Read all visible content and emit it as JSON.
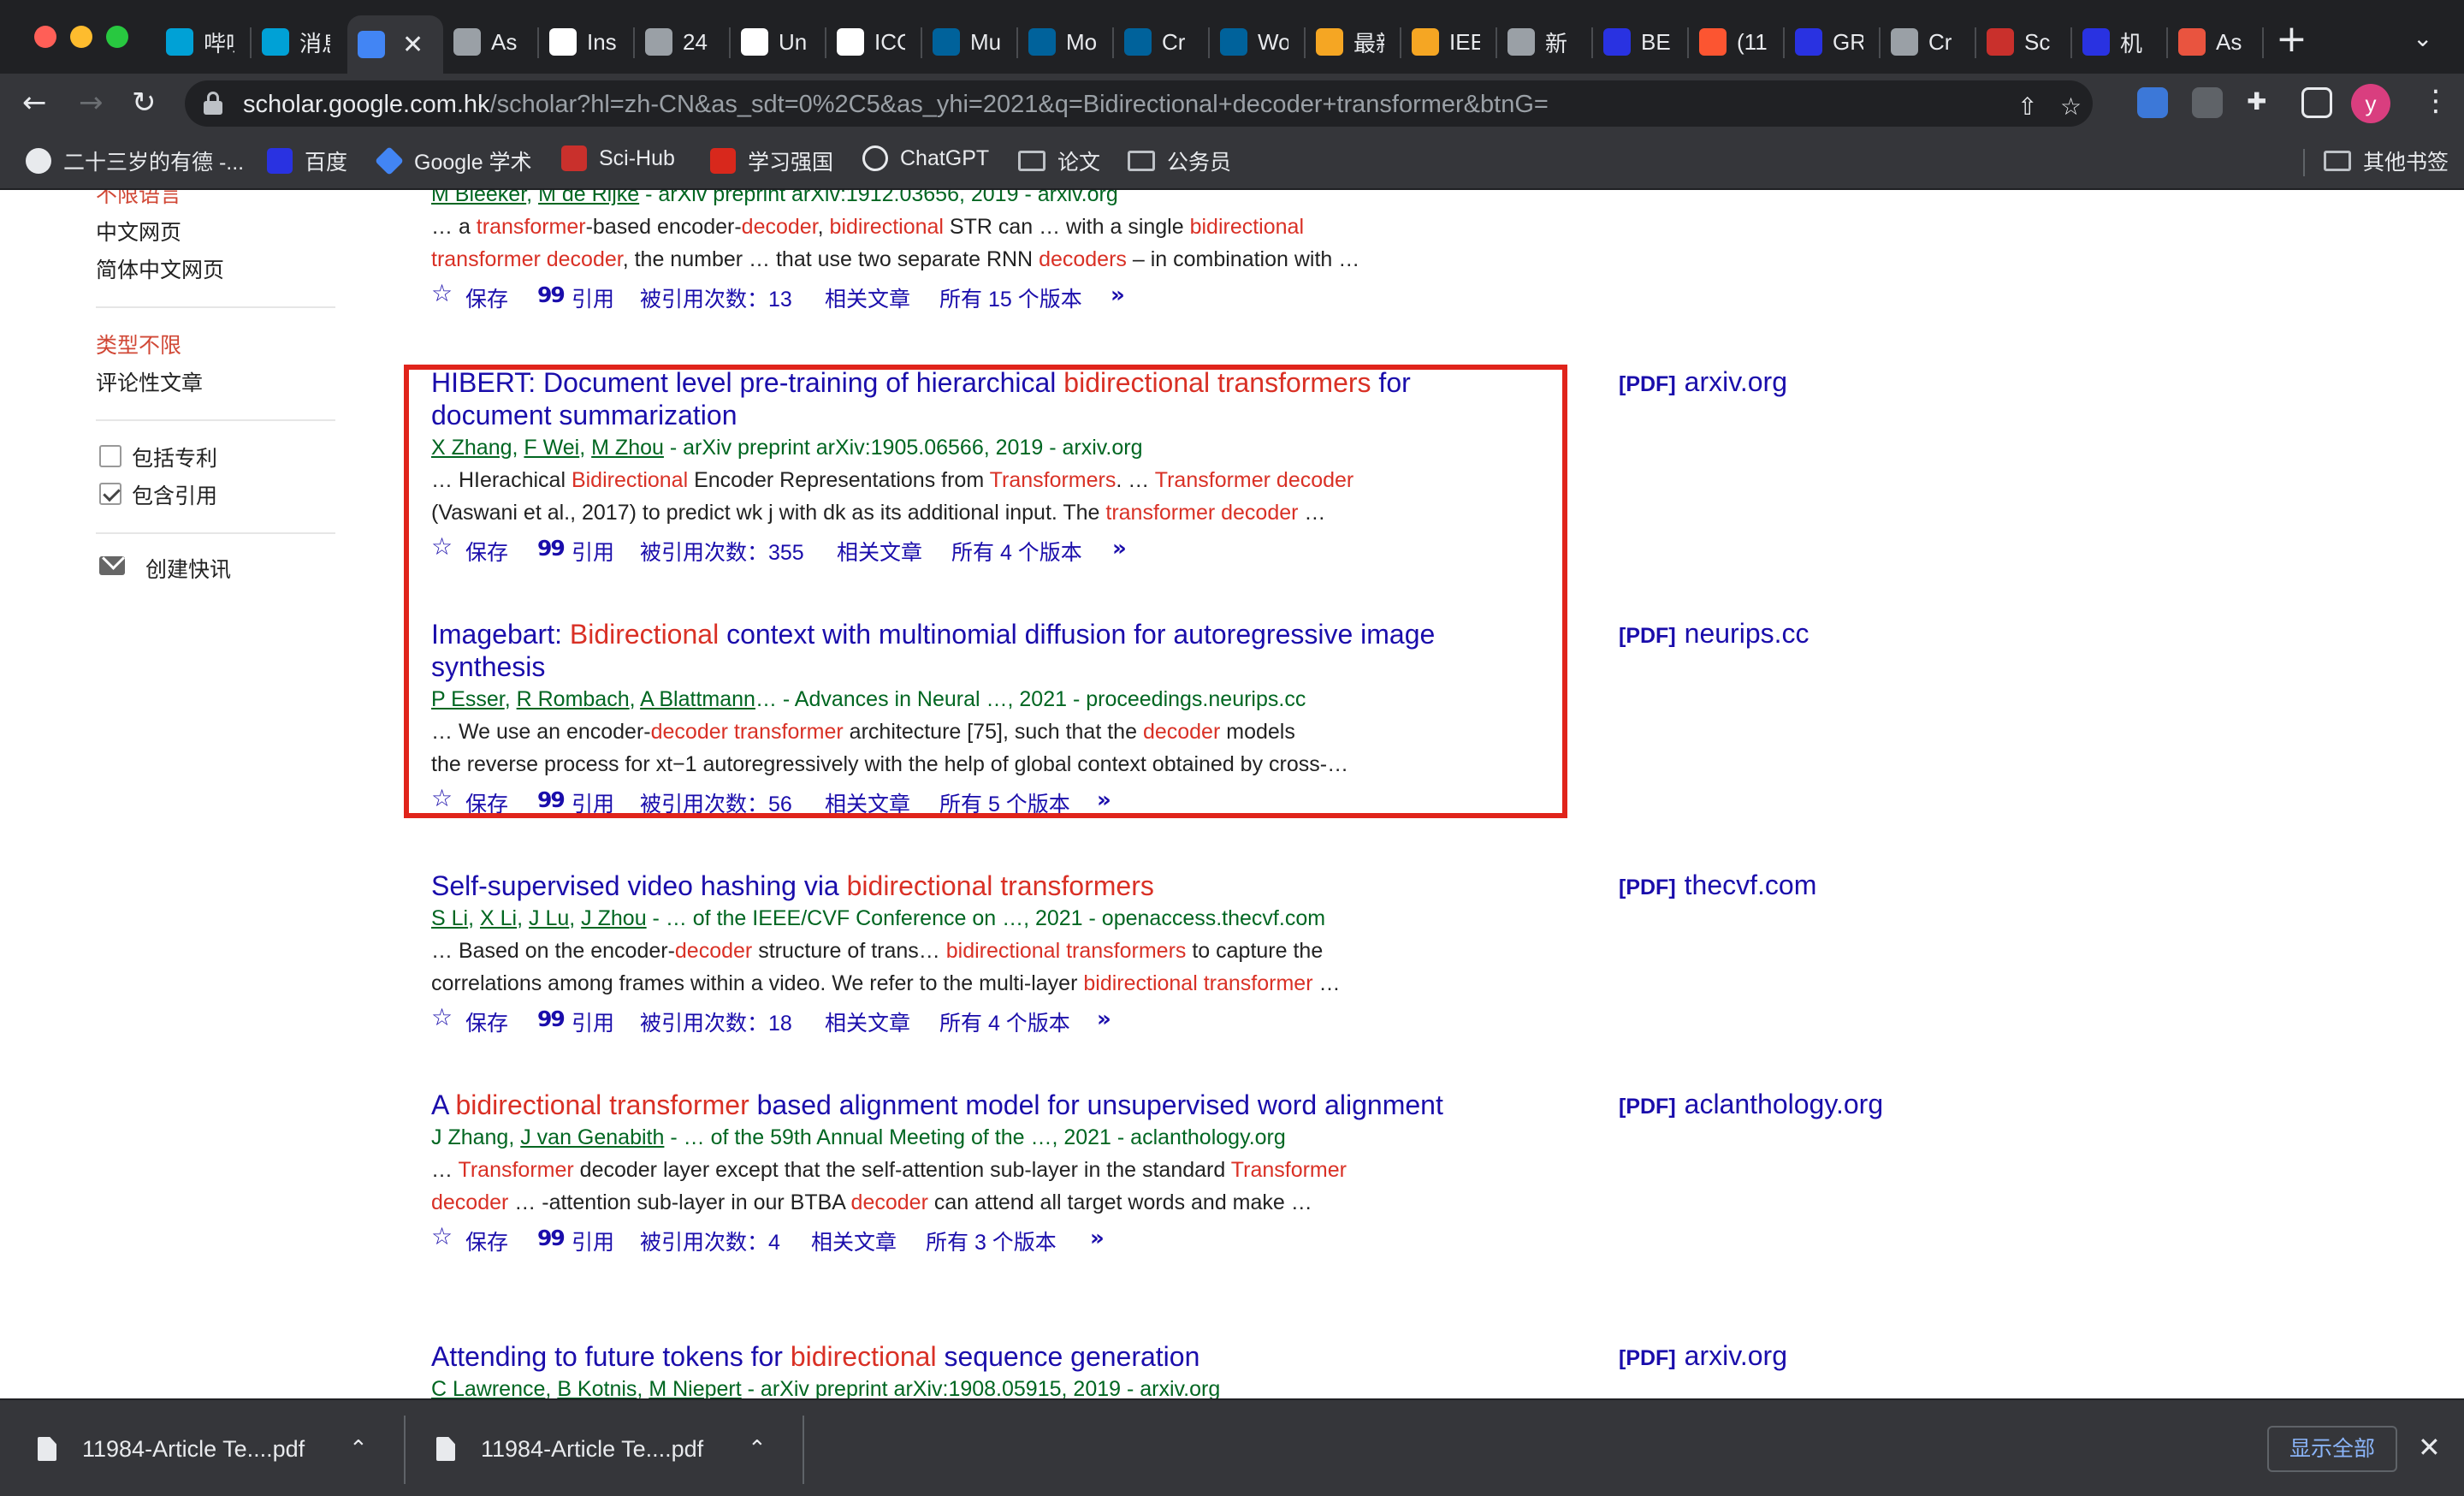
{
  "browser": {
    "tabs": [
      {
        "title": "哔哩",
        "icon": "bilibili-icon",
        "color": "#00a1d6"
      },
      {
        "title": "消息",
        "icon": "bilibili-icon",
        "color": "#00a1d6"
      },
      {
        "title": "",
        "icon": "google-scholar-icon",
        "color": "#4285f4",
        "active": true
      },
      {
        "title": "As",
        "icon": "globe-icon",
        "color": "#9aa0a6"
      },
      {
        "title": "Ins",
        "icon": "researchgate-icon",
        "color": "#ffffff"
      },
      {
        "title": "24",
        "icon": "globe-icon",
        "color": "#9aa0a6"
      },
      {
        "title": "Un",
        "icon": "cvf-icon",
        "color": "#ffffff"
      },
      {
        "title": "ICC",
        "icon": "cvf-icon",
        "color": "#ffffff"
      },
      {
        "title": "Mu",
        "icon": "ieee-icon",
        "color": "#00629b"
      },
      {
        "title": "Mo",
        "icon": "ieee-icon",
        "color": "#00629b"
      },
      {
        "title": "Cr",
        "icon": "ieee-icon",
        "color": "#00629b"
      },
      {
        "title": "Wo",
        "icon": "ieee-icon",
        "color": "#00629b"
      },
      {
        "title": "最新",
        "icon": "p-coin-icon",
        "color": "#f5a623"
      },
      {
        "title": "IEE",
        "icon": "p-coin-icon",
        "color": "#f5a623"
      },
      {
        "title": "新",
        "icon": "globe-icon",
        "color": "#9aa0a6"
      },
      {
        "title": "BE",
        "icon": "baidu-icon",
        "color": "#2932e1"
      },
      {
        "title": "(11",
        "icon": "c-icon",
        "color": "#fc5531"
      },
      {
        "title": "GR",
        "icon": "baidu-icon",
        "color": "#2932e1"
      },
      {
        "title": "Cr",
        "icon": "globe-icon",
        "color": "#9aa0a6"
      },
      {
        "title": "Sc",
        "icon": "scihub-icon",
        "color": "#c9302c"
      },
      {
        "title": "机",
        "icon": "baidu-icon",
        "color": "#2932e1"
      },
      {
        "title": "As",
        "icon": "jian-icon",
        "color": "#e9543f"
      }
    ],
    "url_host": "scholar.google.com.hk",
    "url_path": "/scholar?hl=zh-CN&as_sdt=0%2C5&as_yhi=2021&q=Bidirectional+decoder+transformer&btnG=",
    "bookmarks": [
      {
        "label": "二十三岁的有德 -...",
        "icon": "custom-logo-icon"
      },
      {
        "label": "百度",
        "icon": "baidu-icon"
      },
      {
        "label": "Google 学术",
        "icon": "google-scholar-icon"
      },
      {
        "label": "Sci-Hub",
        "icon": "scihub-icon"
      },
      {
        "label": "学习强国",
        "icon": "xuexi-icon"
      },
      {
        "label": "ChatGPT",
        "icon": "openai-icon"
      },
      {
        "label": "论文",
        "icon": "folder-icon"
      },
      {
        "label": "公务员",
        "icon": "folder-icon"
      }
    ],
    "other_bookmarks": "其他书签",
    "profile_initial": "y"
  },
  "sidebar": {
    "lang_any": "不限语言",
    "lang_zh": "中文网页",
    "lang_zh_simplified": "简体中文网页",
    "type_any": "类型不限",
    "type_review": "评论性文章",
    "include_patents": "包括专利",
    "include_citations": "包含引用",
    "create_alert": "创建快讯"
  },
  "actions": {
    "save": "保存",
    "cite": "引用",
    "related": "相关文章"
  },
  "results": [
    {
      "id": "r0",
      "title_parts": [],
      "authors": [
        "M Bleeker",
        "M de Rijke"
      ],
      "authors_plain_tail": "",
      "venue": " - arXiv preprint arXiv:1912.03656, 2019 - arxiv.org",
      "snippet_lines": [
        [
          [
            "… a ",
            false
          ],
          [
            "transformer",
            true
          ],
          [
            "-based encoder-",
            false
          ],
          [
            "decoder",
            true
          ],
          [
            ", ",
            false
          ],
          [
            "bidirectional",
            true
          ],
          [
            " STR can … with a single ",
            false
          ],
          [
            "bidirectional",
            true
          ]
        ],
        [
          [
            "transformer decoder",
            true
          ],
          [
            ", the number … that use two separate RNN ",
            false
          ],
          [
            "decoders",
            true
          ],
          [
            " – in combination with …",
            false
          ]
        ]
      ],
      "cited_by": "被引用次数：13",
      "versions": "所有 15 个版本",
      "pdf_tag": "",
      "pdf_host": ""
    },
    {
      "id": "r1",
      "title_parts": [
        [
          "HIBERT: Document level pre-training of hierarchical ",
          false
        ],
        [
          "bidirectional transformers",
          true
        ],
        [
          " for document summarization",
          false
        ]
      ],
      "authors": [
        "X Zhang",
        "F Wei",
        "M Zhou"
      ],
      "authors_plain_tail": "",
      "venue": " - arXiv preprint arXiv:1905.06566, 2019 - arxiv.org",
      "snippet_lines": [
        [
          [
            "… HIerachical ",
            false
          ],
          [
            "Bidirectional",
            true
          ],
          [
            " Encoder Representations from ",
            false
          ],
          [
            "Transformers",
            true
          ],
          [
            ". … ",
            false
          ],
          [
            "Transformer decoder",
            true
          ]
        ],
        [
          [
            "(Vaswani et al., 2017) to predict wk j with dk as its additional input. The ",
            false
          ],
          [
            "transformer decoder",
            true
          ],
          [
            " …",
            false
          ]
        ]
      ],
      "cited_by": "被引用次数：355",
      "versions": "所有 4 个版本",
      "pdf_tag": "[PDF]",
      "pdf_host": "arxiv.org"
    },
    {
      "id": "r2",
      "title_parts": [
        [
          "Imagebart: ",
          false
        ],
        [
          "Bidirectional",
          true
        ],
        [
          " context with multinomial diffusion for autoregressive image synthesis",
          false
        ]
      ],
      "authors": [
        "P Esser",
        "R Rombach",
        "A Blattmann"
      ],
      "authors_plain_tail": "…",
      "venue": " - Advances in Neural …, 2021 - proceedings.neurips.cc",
      "snippet_lines": [
        [
          [
            "… We use an encoder-",
            false
          ],
          [
            "decoder transformer",
            true
          ],
          [
            " architecture [75], such that the ",
            false
          ],
          [
            "decoder",
            true
          ],
          [
            " models",
            false
          ]
        ],
        [
          [
            "the reverse process for xt−1 autoregressively with the help of global context obtained by cross-…",
            false
          ]
        ]
      ],
      "cited_by": "被引用次数：56",
      "versions": "所有 5 个版本",
      "pdf_tag": "[PDF]",
      "pdf_host": "neurips.cc"
    },
    {
      "id": "r3",
      "title_parts": [
        [
          "Self-supervised video hashing via ",
          false
        ],
        [
          "bidirectional transformers",
          true
        ]
      ],
      "authors": [
        "S Li",
        "X Li",
        "J Lu",
        "J Zhou"
      ],
      "authors_plain_tail": "",
      "venue": " - … of the IEEE/CVF Conference on …, 2021 - openaccess.thecvf.com",
      "snippet_lines": [
        [
          [
            "… Based on the encoder-",
            false
          ],
          [
            "decoder",
            true
          ],
          [
            " structure of trans… ",
            false
          ],
          [
            "bidirectional transformers",
            true
          ],
          [
            " to capture the",
            false
          ]
        ],
        [
          [
            "correlations among frames within a video. We refer to the multi-layer ",
            false
          ],
          [
            "bidirectional transformer",
            true
          ],
          [
            " …",
            false
          ]
        ]
      ],
      "cited_by": "被引用次数：18",
      "versions": "所有 4 个版本",
      "pdf_tag": "[PDF]",
      "pdf_host": "thecvf.com"
    },
    {
      "id": "r4",
      "title_parts": [
        [
          "A ",
          false
        ],
        [
          "bidirectional transformer",
          true
        ],
        [
          " based alignment model for unsupervised word alignment",
          false
        ]
      ],
      "authors_lead_plain": "J Zhang, ",
      "authors": [
        "J van Genabith"
      ],
      "authors_plain_tail": "",
      "venue": " - … of the 59th Annual Meeting of the …, 2021 - aclanthology.org",
      "snippet_lines": [
        [
          [
            "… ",
            false
          ],
          [
            "Transformer",
            true
          ],
          [
            " decoder layer except that the self-attention sub-layer in the standard ",
            false
          ],
          [
            "Transformer",
            true
          ]
        ],
        [
          [
            "decoder",
            true
          ],
          [
            " … -attention sub-layer in our BTBA ",
            false
          ],
          [
            "decoder",
            true
          ],
          [
            " can attend all target words and make …",
            false
          ]
        ]
      ],
      "cited_by": "被引用次数：4",
      "versions": "所有 3 个版本",
      "pdf_tag": "[PDF]",
      "pdf_host": "aclanthology.org"
    },
    {
      "id": "r5",
      "title_parts": [
        [
          "Attending to future tokens for ",
          false
        ],
        [
          "bidirectional",
          true
        ],
        [
          " sequence generation",
          false
        ]
      ],
      "authors": [
        "C Lawrence",
        "B Kotnis",
        "M Niepert"
      ],
      "authors_plain_tail": "",
      "venue": " - arXiv preprint arXiv:1908.05915, 2019 - arxiv.org",
      "snippet_lines": [],
      "cited_by": "",
      "versions": "",
      "pdf_tag": "[PDF]",
      "pdf_host": "arxiv.org"
    }
  ],
  "downloads": {
    "items": [
      "11984-Article Te....pdf",
      "11984-Article Te....pdf"
    ],
    "show_all": "显示全部"
  }
}
